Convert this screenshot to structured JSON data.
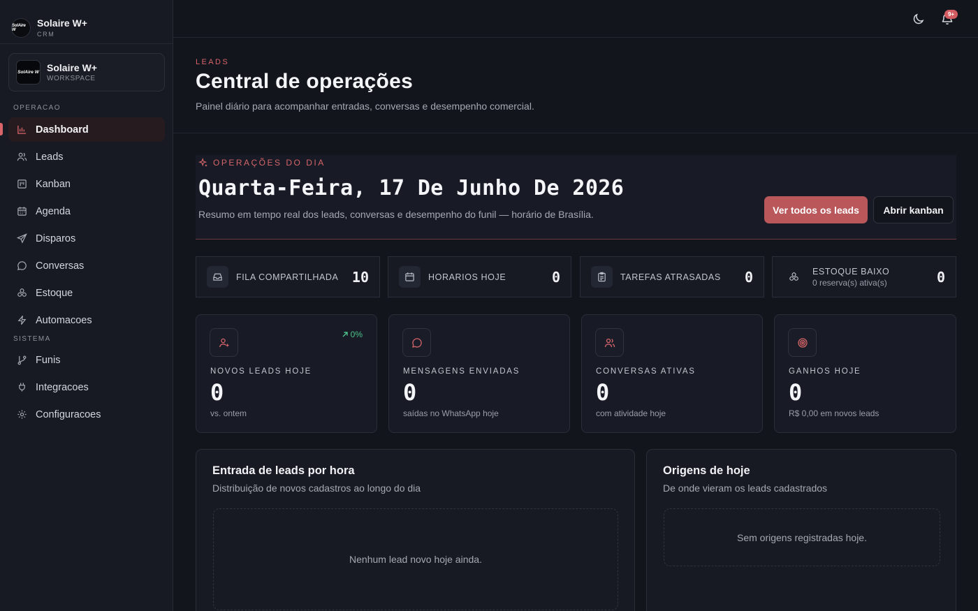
{
  "brand": {
    "name": "Solaire W+",
    "sub": "CRM",
    "logo_text": "SolAire W"
  },
  "workspace": {
    "name": "Solaire W+",
    "sub": "WORKSPACE",
    "logo_text": "SolAire W"
  },
  "sidebar": {
    "section_operacao": "OPERACAO",
    "section_sistema": "SISTEMA",
    "items": [
      {
        "label": "Dashboard",
        "icon": "bar-chart-icon",
        "active": true
      },
      {
        "label": "Leads",
        "icon": "users-icon"
      },
      {
        "label": "Kanban",
        "icon": "kanban-icon"
      },
      {
        "label": "Agenda",
        "icon": "calendar-icon"
      },
      {
        "label": "Disparos",
        "icon": "send-icon"
      },
      {
        "label": "Conversas",
        "icon": "chat-icon"
      },
      {
        "label": "Estoque",
        "icon": "boxes-icon"
      },
      {
        "label": "Automacoes",
        "icon": "zap-icon"
      }
    ],
    "system_items": [
      {
        "label": "Funis",
        "icon": "git-branch-icon"
      },
      {
        "label": "Integracoes",
        "icon": "plug-icon"
      },
      {
        "label": "Configuracoes",
        "icon": "gear-icon"
      }
    ]
  },
  "topbar": {
    "notification_badge": "9+",
    "theme_icon": "moon-icon",
    "bell_icon": "bell-icon"
  },
  "header": {
    "eyebrow": "LEADS",
    "title": "Central de operações",
    "subtitle": "Painel diário para acompanhar entradas, conversas e desempenho comercial."
  },
  "operations": {
    "label": "OPERAÇÕES DO DIA",
    "date": "Quarta-Feira, 17 De Junho De 2026",
    "subtitle": "Resumo em tempo real dos leads, conversas e desempenho do funil — horário de Brasília.",
    "primary_button": "Ver todos os leads",
    "secondary_button": "Abrir kanban"
  },
  "stats": [
    {
      "label": "FILA COMPARTILHADA",
      "sub": "",
      "value": "10",
      "icon": "inbox-icon"
    },
    {
      "label": "HORARIOS HOJE",
      "sub": "",
      "value": "0",
      "icon": "calendar-icon"
    },
    {
      "label": "TAREFAS ATRASADAS",
      "sub": "",
      "value": "0",
      "icon": "clipboard-icon"
    },
    {
      "label": "ESTOQUE BAIXO",
      "sub": "0 reserva(s) ativa(s)",
      "value": "0",
      "icon": "boxes-icon"
    }
  ],
  "metrics": [
    {
      "label": "NOVOS LEADS HOJE",
      "value": "0",
      "sub": "vs. ontem",
      "trend": "0%",
      "icon": "user-plus-icon"
    },
    {
      "label": "MENSAGENS ENVIADAS",
      "value": "0",
      "sub": "saídas no WhatsApp hoje",
      "icon": "chat-icon"
    },
    {
      "label": "CONVERSAS ATIVAS",
      "value": "0",
      "sub": "com atividade hoje",
      "icon": "users-icon"
    },
    {
      "label": "GANHOS HOJE",
      "value": "0",
      "sub": "R$ 0,00 em novos leads",
      "icon": "target-icon"
    }
  ],
  "panels": {
    "hourly": {
      "title": "Entrada de leads por hora",
      "subtitle": "Distribuição de novos cadastros ao longo do dia",
      "empty": "Nenhum lead novo hoje ainda."
    },
    "origins": {
      "title": "Origens de hoje",
      "subtitle": "De onde vieram os leads cadastrados",
      "empty": "Sem origens registradas hoje."
    }
  },
  "colors": {
    "accent": "#d6656a",
    "primary_button": "#b9575b",
    "trend_up": "#4cc38a",
    "background": "#13151c"
  }
}
